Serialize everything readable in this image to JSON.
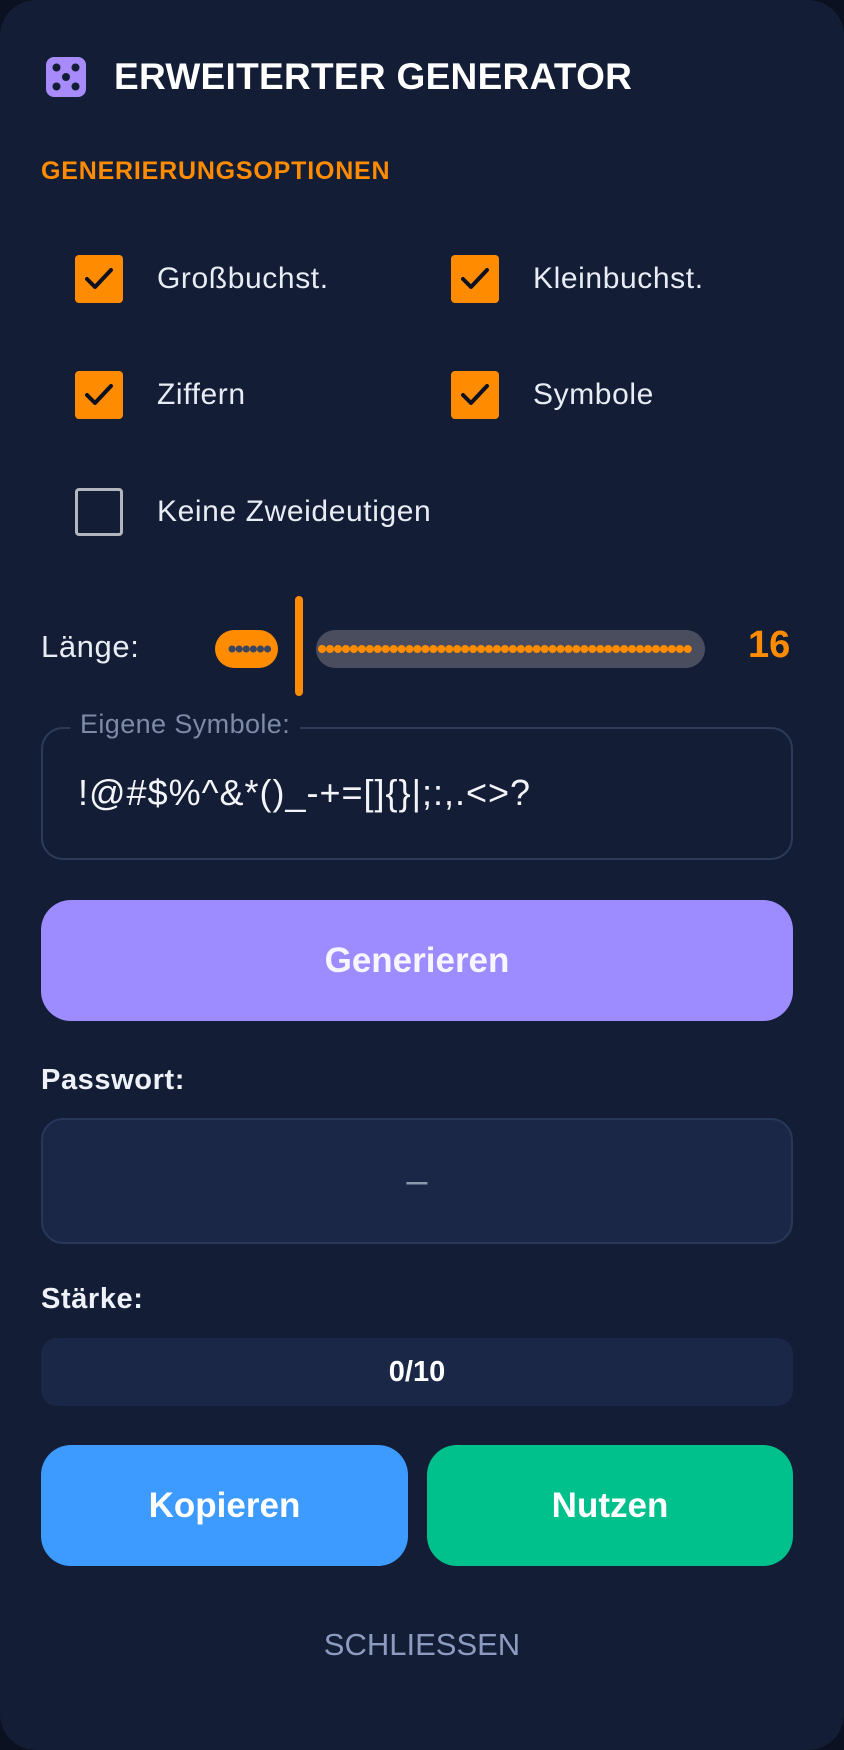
{
  "dialog": {
    "title": "ERWEITERTER GENERATOR",
    "icon": "dice-icon"
  },
  "options": {
    "section_label": "GENERIERUNGSOPTIONEN",
    "items": [
      {
        "label": "Großbuchst.",
        "checked": true
      },
      {
        "label": "Kleinbuchst.",
        "checked": true
      },
      {
        "label": "Ziffern",
        "checked": true
      },
      {
        "label": "Symbole",
        "checked": true
      },
      {
        "label": "Keine Zweideutigen",
        "checked": false
      }
    ]
  },
  "length": {
    "label": "Länge:",
    "value": "16"
  },
  "custom_symbols": {
    "legend": "Eigene Symbole:",
    "value": "!@#$%^&*()_-+=[]{}|;:,.<>?"
  },
  "generate_button": "Generieren",
  "password": {
    "label": "Passwort:",
    "value": "–"
  },
  "strength": {
    "label": "Stärke:",
    "text": "0/10",
    "fraction": 0
  },
  "actions": {
    "copy": "Kopieren",
    "use": "Nutzen",
    "close": "SCHLIESSEN"
  },
  "colors": {
    "background": "#131d35",
    "accent": "#ff8c00",
    "generate": "#9d8cff",
    "copy": "#3d9bff",
    "use": "#00c08b"
  }
}
